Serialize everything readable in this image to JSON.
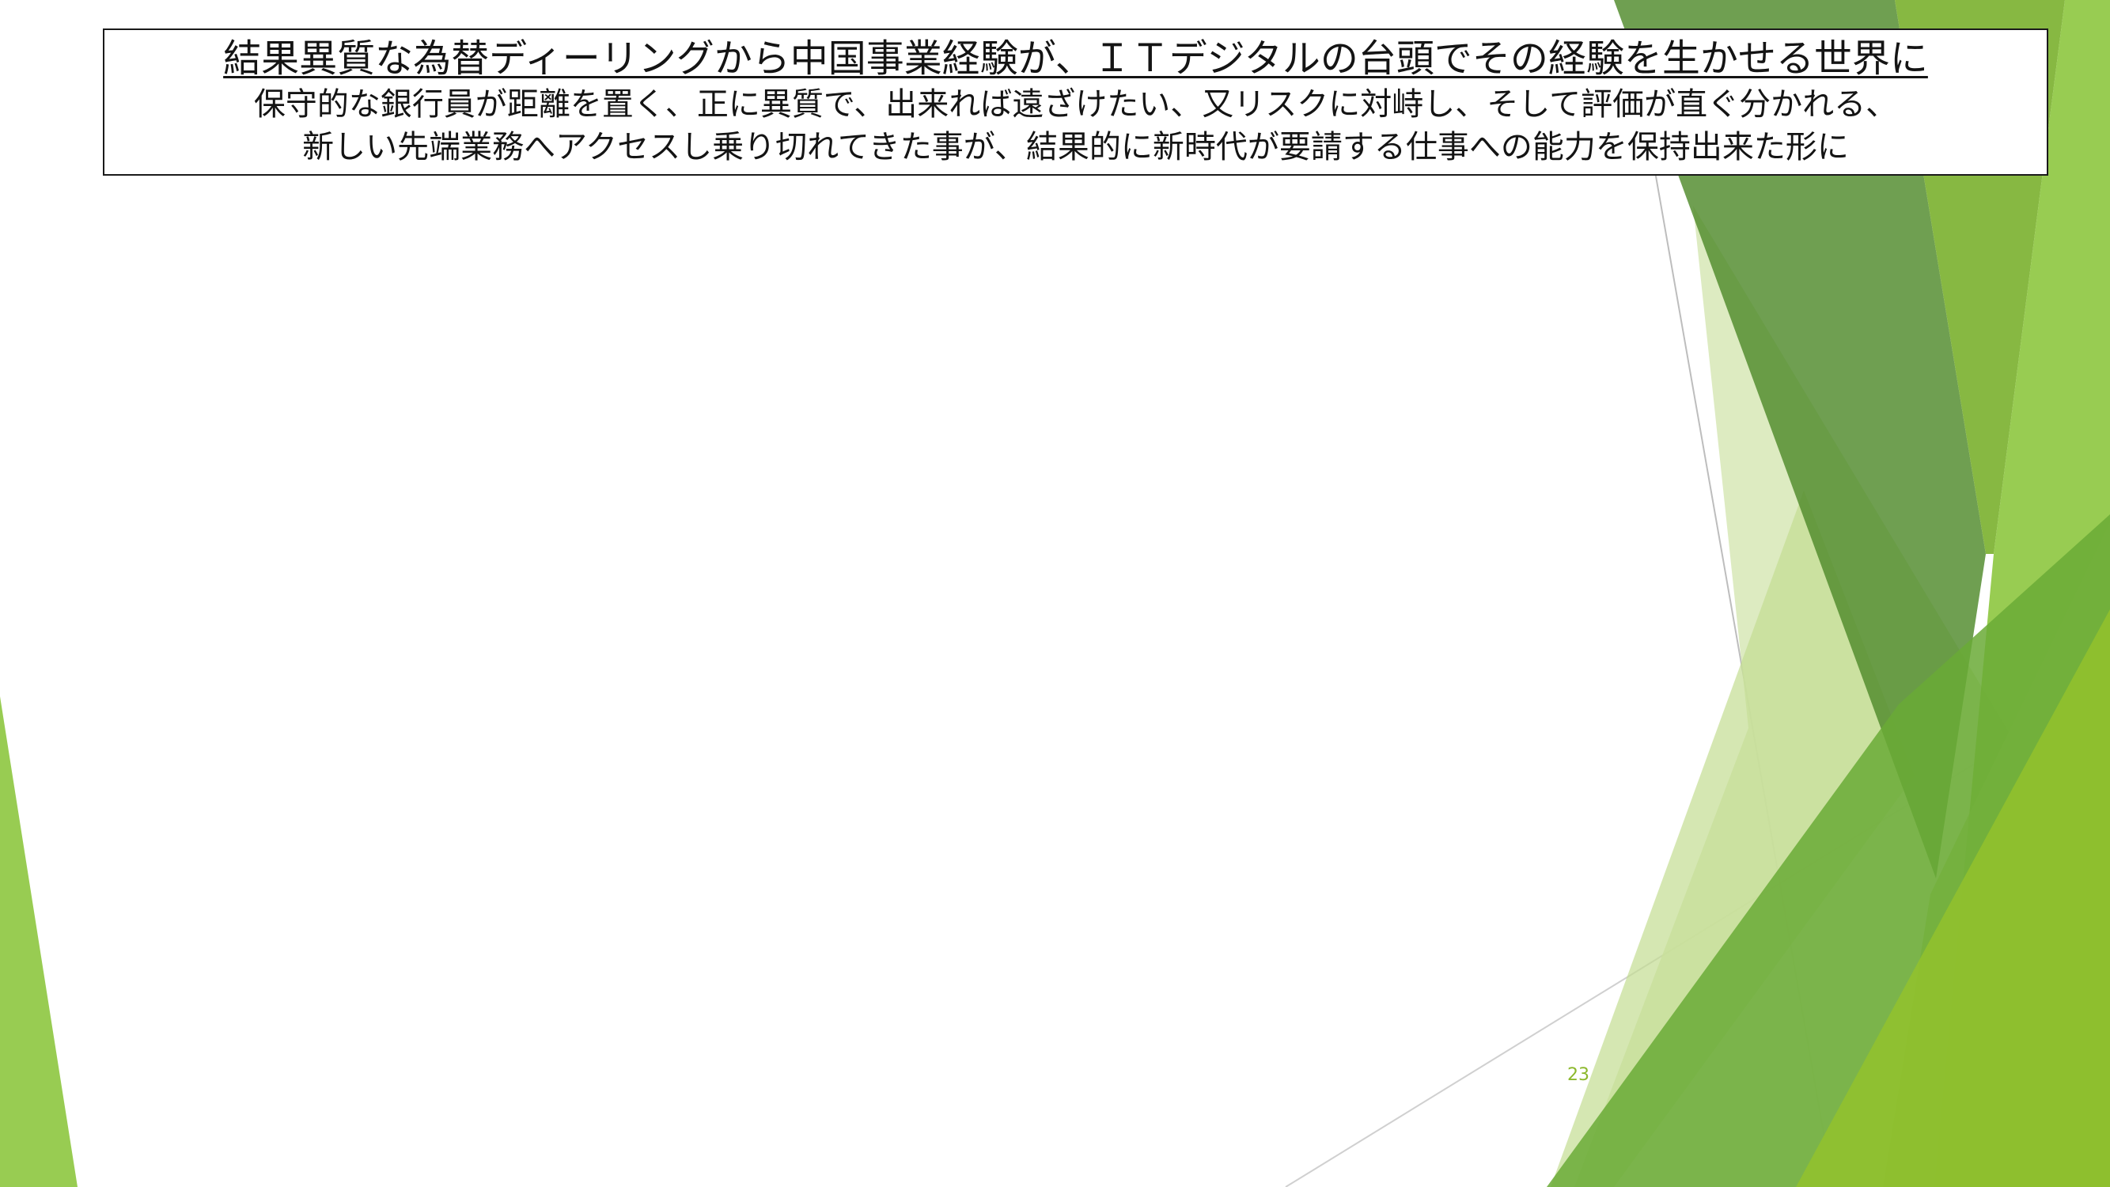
{
  "slide": {
    "title_line": "結果異質な為替ディーリングから中国事業経験が、ＩＴデジタルの台頭でその経験を生かせる世界に",
    "body_line_1": "保守的な銀行員が距離を置く、正に異質で、出来れば遠ざけたい、又リスクに対峙し、そして評価が直ぐ分かれる、",
    "body_line_2": "新しい先端業務へアクセスし乗り切れてきた事が、結果的に新時代が要請する仕事への能力を保持出来た形に",
    "page_number": "23"
  },
  "theme": {
    "accent_green": "#8cb82c",
    "dark_green": "#4f8a2b",
    "light_green": "#d7e8b6",
    "text_color": "#141414"
  }
}
